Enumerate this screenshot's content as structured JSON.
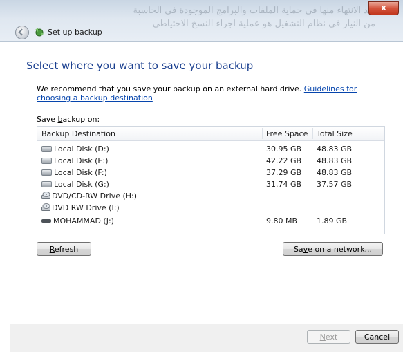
{
  "window": {
    "title": "Set up backup",
    "close_label": "x",
    "background_text_line1": "بعد الانتهاء منها في حماية الملفات والبرامج الموجودة في الحاسبة",
    "background_text_line2": "من النيار في نظام التشغيل هو عملية اجراء النسخ الاحتياطي"
  },
  "page": {
    "heading": "Select where you want to save your backup",
    "intro_text": "We recommend that you save your backup on an external hard drive.",
    "guidelines_link": "Guidelines for choosing a backup destination",
    "save_on_prefix": "Save ",
    "save_on_accel": "b",
    "save_on_suffix": "ackup on:"
  },
  "table": {
    "columns": [
      "Backup Destination",
      "Free Space",
      "Total Size"
    ],
    "rows": [
      {
        "icon": "hard-drive-icon",
        "name": "Local Disk (D:)",
        "free": "30.95 GB",
        "total": "48.83 GB"
      },
      {
        "icon": "hard-drive-icon",
        "name": "Local Disk (E:)",
        "free": "42.22 GB",
        "total": "48.83 GB"
      },
      {
        "icon": "hard-drive-icon",
        "name": "Local Disk (F:)",
        "free": "37.29 GB",
        "total": "48.83 GB"
      },
      {
        "icon": "hard-drive-icon",
        "name": "Local Disk (G:)",
        "free": "31.74 GB",
        "total": "37.57 GB"
      },
      {
        "icon": "dvd-drive-icon",
        "name": "DVD/CD-RW Drive (H:)",
        "free": "",
        "total": ""
      },
      {
        "icon": "dvd-drive-icon",
        "name": "DVD RW Drive (I:)",
        "free": "",
        "total": ""
      },
      {
        "icon": "usb-drive-icon",
        "name": "MOHAMMAD (J:)",
        "free": "9.80 MB",
        "total": "1.89 GB"
      }
    ]
  },
  "buttons": {
    "refresh_accel": "R",
    "refresh_rest": "efresh",
    "network_prefix": "Sa",
    "network_accel": "v",
    "network_suffix": "e on a network...",
    "next_accel": "N",
    "next_rest": "ext",
    "cancel": "Cancel"
  },
  "colors": {
    "heading": "#1a3f8f",
    "link": "#0645ad",
    "close_button": "#c1361d"
  }
}
